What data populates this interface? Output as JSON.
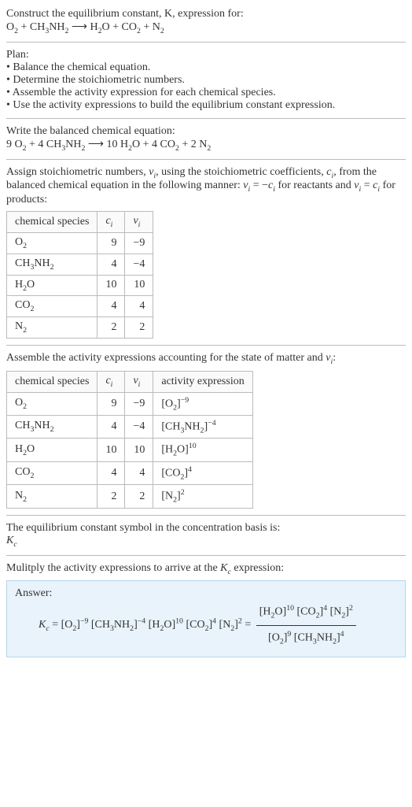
{
  "intro": {
    "prompt_line1": "Construct the equilibrium constant, K, expression for:",
    "eq_unbalanced_before": "O",
    "eq_plus1": " + CH",
    "eq_nh2": "NH",
    "eq_arrow": " ⟶ H",
    "eq_o_co2": "O + CO",
    "eq_plus_n2": " + N"
  },
  "plan": {
    "title": "Plan:",
    "b1": "• Balance the chemical equation.",
    "b2": "• Determine the stoichiometric numbers.",
    "b3": "• Assemble the activity expression for each chemical species.",
    "b4": "• Use the activity expressions to build the equilibrium constant expression."
  },
  "balanced": {
    "title": "Write the balanced chemical equation:",
    "c1": "9 O",
    "c2": " + 4 CH",
    "c3": "NH",
    "c4": " ⟶ 10 H",
    "c5": "O + 4 CO",
    "c6": " + 2 N"
  },
  "assign": {
    "text_a": "Assign stoichiometric numbers, ",
    "vi": "ν",
    "text_b": ", using the stoichiometric coefficients, ",
    "ci": "c",
    "text_c": ", from the balanced chemical equation in the following manner: ",
    "rel1": " = −",
    "text_d": " for reactants and ",
    "rel2": " = ",
    "text_e": " for products:"
  },
  "table1": {
    "h1": "chemical species",
    "h2": "c",
    "h3": "ν",
    "rows": [
      {
        "sp": "O",
        "spsub": "2",
        "c": "9",
        "v": "−9"
      },
      {
        "sp": "CH",
        "spmid": "3",
        "sp2": "NH",
        "spsub": "2",
        "c": "4",
        "v": "−4"
      },
      {
        "sp": "H",
        "spmid": "2",
        "sp2": "O",
        "spsub": "",
        "c": "10",
        "v": "10"
      },
      {
        "sp": "CO",
        "spsub": "2",
        "c": "4",
        "v": "4"
      },
      {
        "sp": "N",
        "spsub": "2",
        "c": "2",
        "v": "2"
      }
    ]
  },
  "assemble_text": "Assemble the activity expressions accounting for the state of matter and ",
  "assemble_tail": ":",
  "table2": {
    "h1": "chemical species",
    "h2": "c",
    "h3": "ν",
    "h4": "activity expression",
    "rows": [
      {
        "sp": "O",
        "spsub": "2",
        "c": "9",
        "v": "−9",
        "act": "[O",
        "actsub": "2",
        "exp": "−9"
      },
      {
        "sp": "CH",
        "spmid": "3",
        "sp2": "NH",
        "spsub": "2",
        "c": "4",
        "v": "−4",
        "act": "[CH",
        "actmid": "3",
        "act2": "NH",
        "actsub": "2",
        "exp": "−4"
      },
      {
        "sp": "H",
        "spmid": "2",
        "sp2": "O",
        "spsub": "",
        "c": "10",
        "v": "10",
        "act": "[H",
        "actmid": "2",
        "act2": "O]",
        "exp": "10"
      },
      {
        "sp": "CO",
        "spsub": "2",
        "c": "4",
        "v": "4",
        "act": "[CO",
        "actsub": "2",
        "exp": "4"
      },
      {
        "sp": "N",
        "spsub": "2",
        "c": "2",
        "v": "2",
        "act": "[N",
        "actsub": "2",
        "exp": "2"
      }
    ]
  },
  "kc_text": "The equilibrium constant symbol in the concentration basis is:",
  "kc_symbol": "K",
  "multiply_text_a": "Mulitply the activity expressions to arrive at the ",
  "multiply_text_b": " expression:",
  "answer_label": "Answer:",
  "chart_data": {
    "type": "table",
    "title": "Stoichiometric numbers and activity expressions",
    "species": [
      "O2",
      "CH3NH2",
      "H2O",
      "CO2",
      "N2"
    ],
    "c_i": [
      9,
      4,
      10,
      4,
      2
    ],
    "nu_i": [
      -9,
      -4,
      10,
      4,
      2
    ],
    "activity_exponents": [
      -9,
      -4,
      10,
      4,
      2
    ],
    "balanced_equation": "9 O2 + 4 CH3NH2 -> 10 H2O + 4 CO2 + 2 N2",
    "Kc_expression": "([H2O]^10 [CO2]^4 [N2]^2) / ([O2]^9 [CH3NH2]^4)"
  }
}
